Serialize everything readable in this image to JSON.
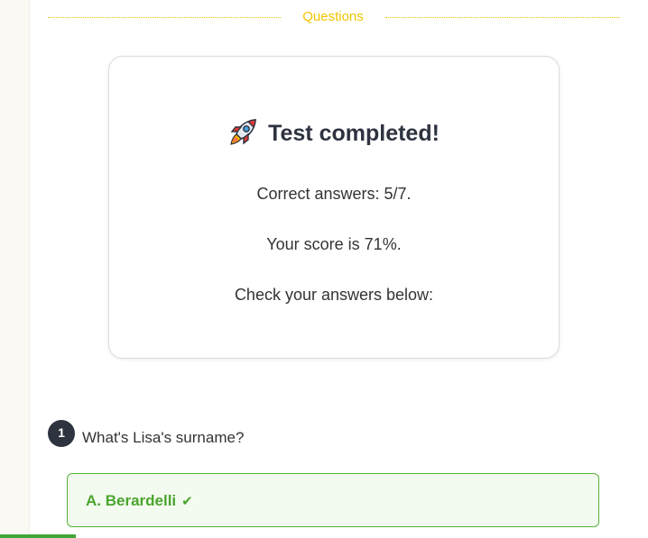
{
  "section": {
    "title": "Questions"
  },
  "result": {
    "icon": "rocket-icon",
    "heading": "Test completed!",
    "correct_answers": "Correct answers: 5/7.",
    "score": "Your score is 71%.",
    "instruction": "Check your answers below:"
  },
  "questions": [
    {
      "number": "1",
      "text": "What's Lisa's surname?",
      "answer": {
        "label": "A. Berardelli",
        "status_icon": "check-icon",
        "status": "correct"
      }
    }
  ],
  "progress": {
    "fraction": 0.117
  },
  "colors": {
    "accent_yellow": "#f2c400",
    "correct_green": "#4aa52e",
    "dark": "#2e3340"
  }
}
